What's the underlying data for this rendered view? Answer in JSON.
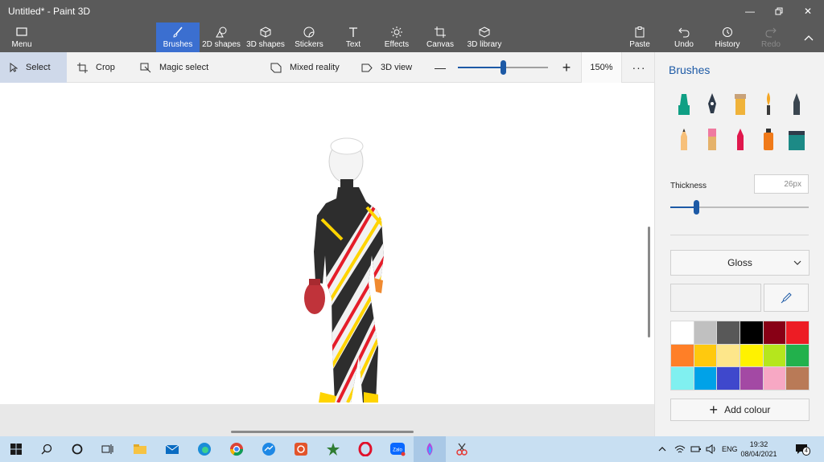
{
  "window": {
    "title": "Untitled* - Paint 3D",
    "controls": [
      "minimize",
      "maximize",
      "close"
    ]
  },
  "ribbon": {
    "menu": "Menu",
    "tools": [
      {
        "label": "Brushes",
        "icon": "brush-icon",
        "active": true
      },
      {
        "label": "2D shapes",
        "icon": "2d-shapes-icon"
      },
      {
        "label": "3D shapes",
        "icon": "3d-shapes-icon"
      },
      {
        "label": "Stickers",
        "icon": "stickers-icon"
      },
      {
        "label": "Text",
        "icon": "text-icon"
      },
      {
        "label": "Effects",
        "icon": "effects-icon"
      },
      {
        "label": "Canvas",
        "icon": "canvas-icon"
      },
      {
        "label": "3D library",
        "icon": "3d-library-icon"
      }
    ],
    "paste": "Paste",
    "undo": "Undo",
    "history": "History",
    "redo": "Redo"
  },
  "toolbar": {
    "select": "Select",
    "crop": "Crop",
    "magic_select": "Magic select",
    "mixed_reality": "Mixed reality",
    "view_3d": "3D view",
    "zoom": "150%",
    "zoom_fraction": 0.5
  },
  "panel": {
    "title": "Brushes",
    "brushes": [
      "marker-icon",
      "calligraphy-pen-icon",
      "oil-brush-icon",
      "watercolor-icon",
      "pixel-pen-icon",
      "pencil-icon",
      "eraser-icon",
      "crayon-icon",
      "spray-can-icon",
      "fill-icon"
    ],
    "thickness_label": "Thickness",
    "thickness_value": "26px",
    "thickness_fraction": 0.19,
    "finish": "Gloss",
    "palette": [
      "#ffffff",
      "#c0c0c0",
      "#585858",
      "#000000",
      "#880015",
      "#ed1c24",
      "#ff7f27",
      "#ffc90e",
      "#fde68a",
      "#fff200",
      "#b5e61d",
      "#22b14c",
      "#80f0f0",
      "#00a2e8",
      "#3f48cc",
      "#a349a4",
      "#f7a8c4",
      "#b97a57"
    ],
    "add_colour": "Add colour"
  },
  "taskbar": {
    "apps": [
      "windows-start-icon",
      "search-icon",
      "cortana-icon",
      "task-view-icon",
      "file-explorer-icon",
      "mail-icon",
      "edge-icon",
      "chrome-icon",
      "messenger-icon",
      "app-red-icon",
      "pinned-star-icon",
      "opera-icon",
      "zalo-icon",
      "paint-3d-icon",
      "snip-icon"
    ],
    "language": "ENG",
    "time": "19:32",
    "date": "08/04/2021",
    "notifications": "4"
  },
  "colors": {
    "titlebar": "#5a5a5a",
    "accent": "#3b6fd0",
    "panel_title": "#1d5aa6"
  }
}
